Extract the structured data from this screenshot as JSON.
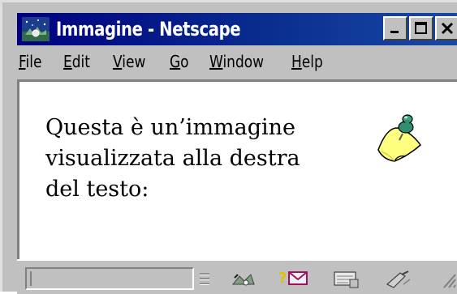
{
  "window": {
    "title": "Immagine - Netscape",
    "buttons": {
      "minimize": "_",
      "maximize": "□",
      "close": "×"
    }
  },
  "menu": [
    {
      "label": "File",
      "accesskey": "F",
      "rest": "ile"
    },
    {
      "label": "Edit",
      "accesskey": "E",
      "rest": "dit"
    },
    {
      "label": "View",
      "accesskey": "V",
      "rest": "iew"
    },
    {
      "label": "Go",
      "accesskey": "G",
      "rest": "o"
    },
    {
      "label": "Window",
      "accesskey": "W",
      "rest": "indow"
    },
    {
      "label": "Help",
      "accesskey": "H",
      "rest": "elp"
    }
  ],
  "content": {
    "text_lines": [
      "Questa è un’immagine",
      "visualizzata alla destra",
      "del testo:"
    ],
    "image_icon": "pinned-note-icon"
  },
  "statusbar": {
    "status_text": "",
    "icons": [
      "navigator-icon",
      "mail-icon",
      "discussion-icon",
      "composer-icon"
    ]
  },
  "colors": {
    "titlebar": "#000080",
    "chrome": "#c0c0c0",
    "content_bg": "#ffffff"
  }
}
